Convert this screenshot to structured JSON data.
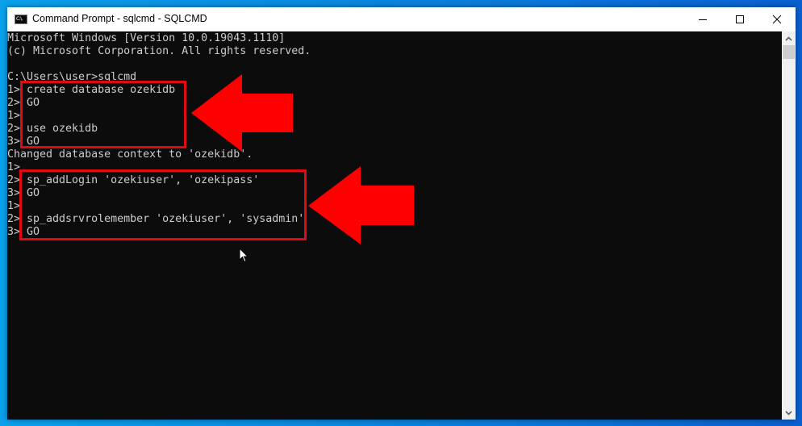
{
  "window": {
    "title": "Command Prompt - sqlcmd - SQLCMD",
    "icon": "cmd-icon",
    "icon_text": "C:\\.",
    "controls": {
      "minimize": "minimize-icon",
      "maximize": "maximize-icon",
      "close": "close-icon"
    }
  },
  "console": {
    "lines": [
      "Microsoft Windows [Version 10.0.19043.1110]",
      "(c) Microsoft Corporation. All rights reserved.",
      "",
      "C:\\Users\\user>sqlcmd",
      "1> create database ozekidb",
      "2> GO",
      "1>",
      "2> use ozekidb",
      "3> GO",
      "Changed database context to 'ozekidb'.",
      "1>",
      "2> sp_addLogin 'ozekiuser', 'ozekipass'",
      "3> GO",
      "1>",
      "2> sp_addsrvrolemember 'ozekiuser', 'sysadmin'",
      "3> GO"
    ],
    "text_color": "#cccccc",
    "background": "#0c0c0c"
  },
  "annotations": {
    "color": "#ff0000",
    "boxes": [
      {
        "label": "create-and-use-database",
        "covers_lines": [
          4,
          8
        ]
      },
      {
        "label": "add-login-and-role",
        "covers_lines": [
          11,
          15
        ]
      }
    ],
    "arrows": [
      {
        "label": "arrow-to-database-commands",
        "direction": "left"
      },
      {
        "label": "arrow-to-login-commands",
        "direction": "left"
      }
    ]
  },
  "scrollbar": {
    "up": "chevron-up-icon",
    "down": "chevron-down-icon"
  }
}
